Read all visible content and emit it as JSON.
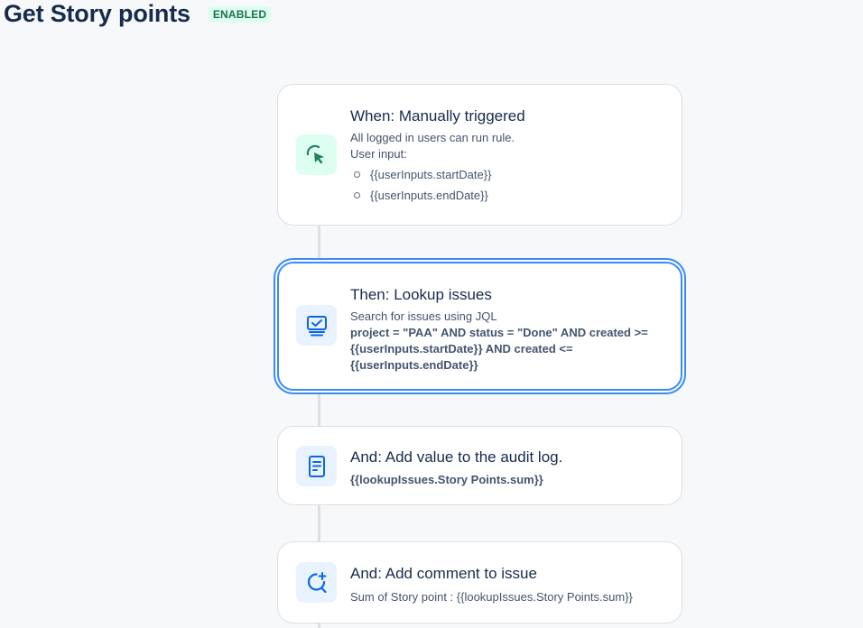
{
  "header": {
    "title": "Get Story points",
    "status": "ENABLED"
  },
  "rule_steps": [
    {
      "title": "When: Manually triggered",
      "description": "All logged in users can run rule.",
      "sub_label": "User input:",
      "inputs": [
        "{{userInputs.startDate}}",
        "{{userInputs.endDate}}"
      ],
      "icon": "cursor-click-icon",
      "icon_color": "#1f845a"
    },
    {
      "title": "Then: Lookup issues",
      "description": "Search for issues using JQL",
      "detail": "project = \"PAA\" AND status = \"Done\" AND created >= {{userInputs.startDate}} AND created <= {{userInputs.endDate}}",
      "icon": "lookup-issues-icon",
      "icon_color": "#0c66e4"
    },
    {
      "title": "And: Add value to the audit log.",
      "detail": "{{lookupIssues.Story Points.sum}}",
      "icon": "audit-log-icon",
      "icon_color": "#0c66e4"
    },
    {
      "title": "And: Add comment to issue",
      "description": "Sum of Story point : {{lookupIssues.Story Points.sum}}",
      "icon": "add-comment-icon",
      "icon_color": "#0c66e4"
    }
  ]
}
